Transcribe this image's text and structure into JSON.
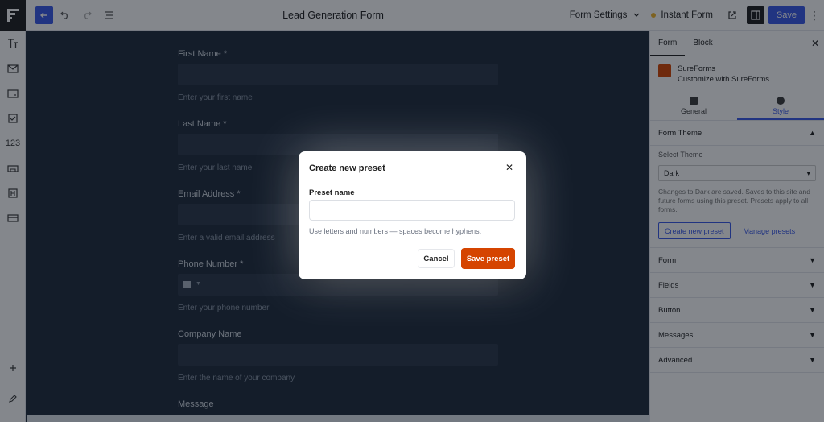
{
  "topbar": {
    "title": "Lead Generation Form",
    "form_settings": "Form Settings",
    "instant_form": "Instant Form",
    "save": "Save"
  },
  "left_toolbar": {
    "numbers_label": "123"
  },
  "canvas": {
    "fields": [
      {
        "label": "First Name",
        "required": "*",
        "help": "Enter your first name"
      },
      {
        "label": "Last Name",
        "required": "*",
        "help": "Enter your last name"
      },
      {
        "label": "Email Address",
        "required": "*",
        "help": "Enter a valid email address"
      },
      {
        "label": "Phone Number",
        "required": "*",
        "help": "Enter your phone number"
      },
      {
        "label": "Company Name",
        "required": "",
        "help": "Enter the name of your company"
      },
      {
        "label": "Message",
        "required": "",
        "help": ""
      }
    ]
  },
  "sidebar": {
    "tabs": [
      "Form",
      "Block"
    ],
    "brand_name": "SureForms",
    "brand_sub": "Customize with SureForms",
    "subtabs": [
      "General",
      "Style"
    ],
    "form_theme": {
      "title": "Form Theme",
      "select_label": "Select Theme",
      "selected": "Dark",
      "description": "Changes to Dark are saved. Saves to this site and future forms using this preset. Presets apply to all forms.",
      "create_preset": "Create new preset",
      "manage_presets": "Manage presets"
    },
    "sections": [
      "Form",
      "Fields",
      "Button",
      "Messages",
      "Advanced"
    ]
  },
  "modal": {
    "title": "Create new preset",
    "field_label": "Preset name",
    "input_value": "",
    "input_placeholder": "",
    "hint": "Use letters and numbers — spaces become hyphens.",
    "cancel": "Cancel",
    "save": "Save preset"
  },
  "colors": {
    "accent": "#3858e9",
    "primary_action": "#d54400",
    "canvas_bg": "#1e2a3b"
  }
}
